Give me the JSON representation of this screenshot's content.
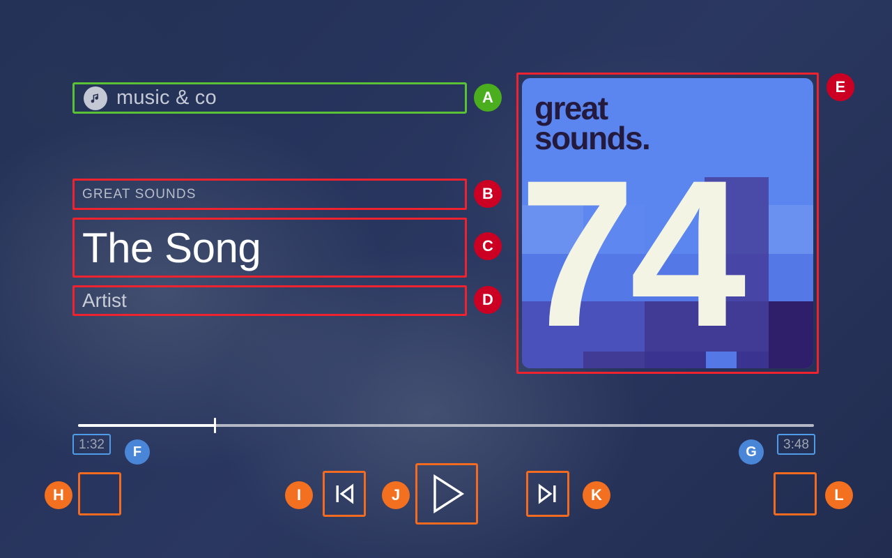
{
  "app": {
    "brand_name": "music & co",
    "brand_icon": "music-note-icon"
  },
  "now_playing": {
    "album_label": "GREAT SOUNDS",
    "title": "The Song",
    "artist": "Artist"
  },
  "album_art": {
    "brand_line_1": "great",
    "brand_line_2": "sounds.",
    "number": "74",
    "colors": {
      "base_blue": "#5b85ef",
      "mid_blue": "#4f73dd",
      "deep_blue": "#4356c4",
      "purple": "#4a3d9e",
      "dark_purple": "#3b2a7e",
      "darkest_purple": "#2f1f6b",
      "cream": "#f3f4e3",
      "ink": "#231a3e"
    }
  },
  "progress": {
    "elapsed": "1:32",
    "total": "3:48",
    "percent": 18.6
  },
  "controls": [
    {
      "id": "shuffle",
      "label": ""
    },
    {
      "id": "previous",
      "label": ""
    },
    {
      "id": "play",
      "label": ""
    },
    {
      "id": "next",
      "label": ""
    },
    {
      "id": "repeat",
      "label": ""
    }
  ],
  "annotations": [
    {
      "id": "a",
      "letter": "A",
      "color": "#4aae1e",
      "target": "brand-bar"
    },
    {
      "id": "b",
      "letter": "B",
      "color": "#cc0022",
      "target": "album-label"
    },
    {
      "id": "c",
      "letter": "C",
      "color": "#cc0022",
      "target": "track-title"
    },
    {
      "id": "d",
      "letter": "D",
      "color": "#cc0022",
      "target": "artist-name"
    },
    {
      "id": "e",
      "letter": "E",
      "color": "#cc0022",
      "target": "album-art"
    },
    {
      "id": "f",
      "letter": "F",
      "color": "#4a86d8",
      "target": "elapsed-time"
    },
    {
      "id": "g",
      "letter": "G",
      "color": "#4a86d8",
      "target": "total-time"
    },
    {
      "id": "h",
      "letter": "H",
      "color": "#f2701f",
      "target": "shuffle-button"
    },
    {
      "id": "i",
      "letter": "I",
      "color": "#f2701f",
      "target": "previous-button"
    },
    {
      "id": "j",
      "letter": "J",
      "color": "#f2701f",
      "target": "play-button"
    },
    {
      "id": "k",
      "letter": "K",
      "color": "#f2701f",
      "target": "next-button"
    },
    {
      "id": "l",
      "letter": "L",
      "color": "#f2701f",
      "target": "repeat-button"
    }
  ]
}
